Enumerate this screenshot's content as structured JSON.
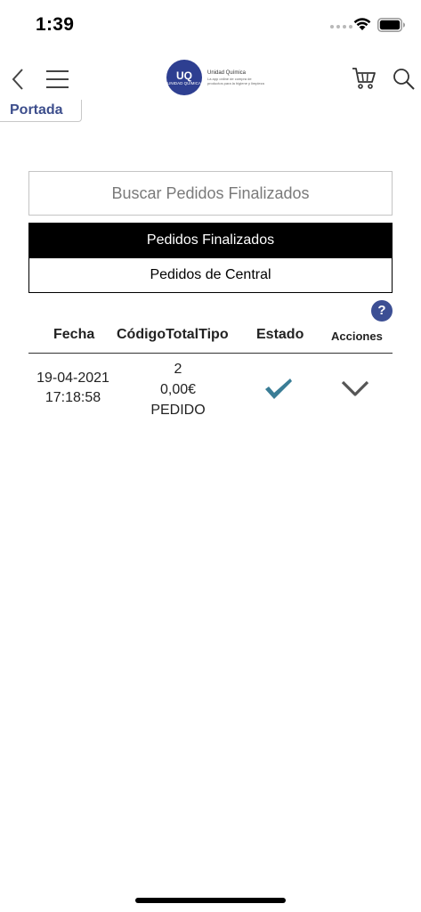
{
  "status_bar": {
    "time": "1:39"
  },
  "header": {
    "logo_mark": "UQ",
    "logo_sub": "UNIDAD QUÍMICA",
    "logo_name": "Unidad Química",
    "logo_tagline": "La app online de compra de productos para la higiene y limpieza"
  },
  "breadcrumb": {
    "portada_label": "Portada"
  },
  "search": {
    "placeholder": "Buscar Pedidos Finalizados"
  },
  "tabs": [
    {
      "label": "Pedidos Finalizados",
      "active": true
    },
    {
      "label": "Pedidos de Central",
      "active": false
    }
  ],
  "help": {
    "label": "?"
  },
  "table": {
    "columns": {
      "fecha": "Fecha",
      "codigo_total_tipo": "CódigoTotalTipo",
      "estado": "Estado",
      "acciones": "Acciones"
    },
    "rows": [
      {
        "date": "19-04-2021",
        "time": "17:18:58",
        "codigo": "2",
        "total": "0,00€",
        "tipo": "PEDIDO",
        "estado_icon": "checkmark-icon",
        "acciones_icon": "chevron-down-icon"
      }
    ]
  },
  "colors": {
    "brand": "#2e3f91",
    "check": "#3a7d96",
    "portada_text": "#3d4e8c"
  }
}
